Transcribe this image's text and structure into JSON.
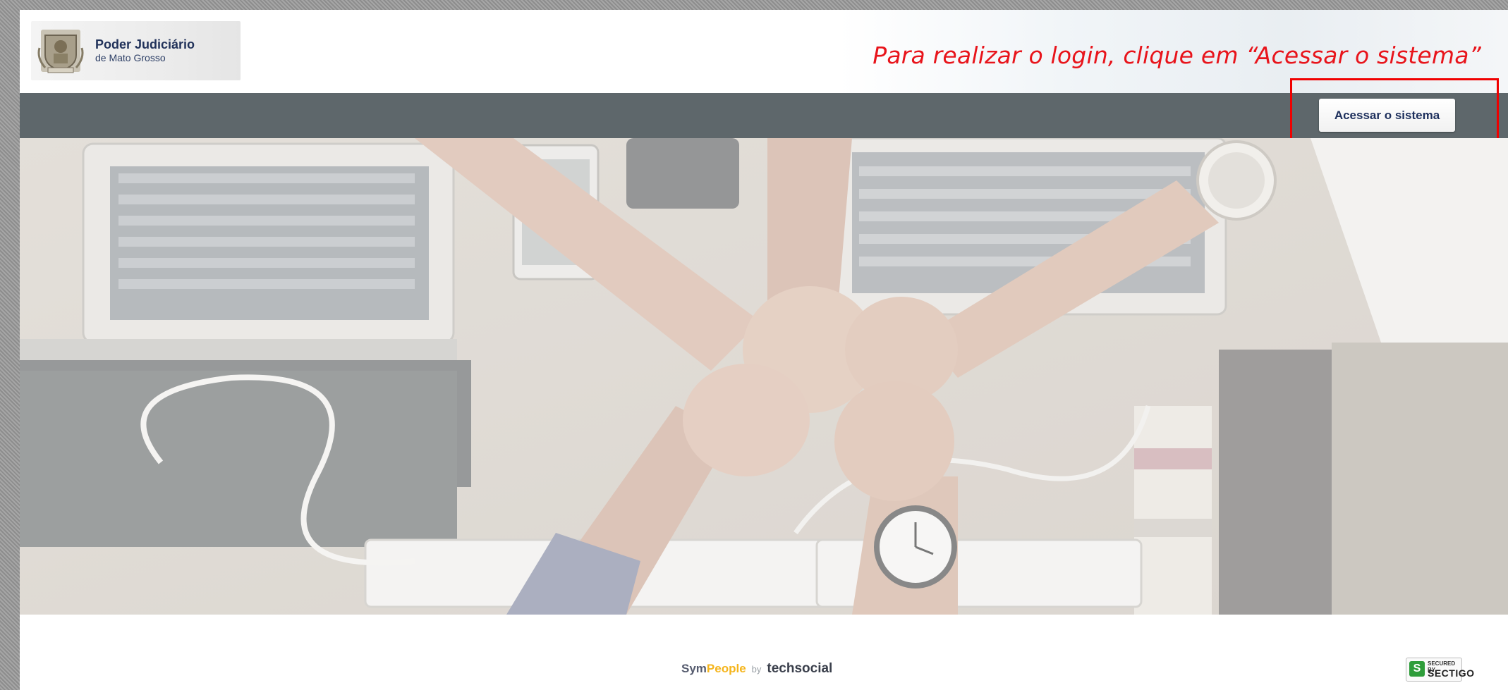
{
  "header": {
    "logo_title": "Poder Judiciário",
    "logo_subtitle": "de Mato Grosso",
    "instruction": "Para realizar o login, clique em “Acessar o sistema”"
  },
  "navbar": {
    "access_button_label": "Acessar o sistema"
  },
  "footer": {
    "brand_sym": "Sym",
    "brand_people": "People",
    "brand_by": "by",
    "brand_tech": "techsocial",
    "seal_top": "SECURED BY",
    "seal_main": "SECTIGO",
    "seal_icon": "S"
  },
  "colors": {
    "instruction": "#e8141b",
    "navbar": "#5e676b",
    "highlight": "#f00000",
    "people_accent": "#f5b51c"
  },
  "icons": {
    "crest": "coat-of-arms-icon",
    "seal": "sectigo-shield-icon"
  }
}
